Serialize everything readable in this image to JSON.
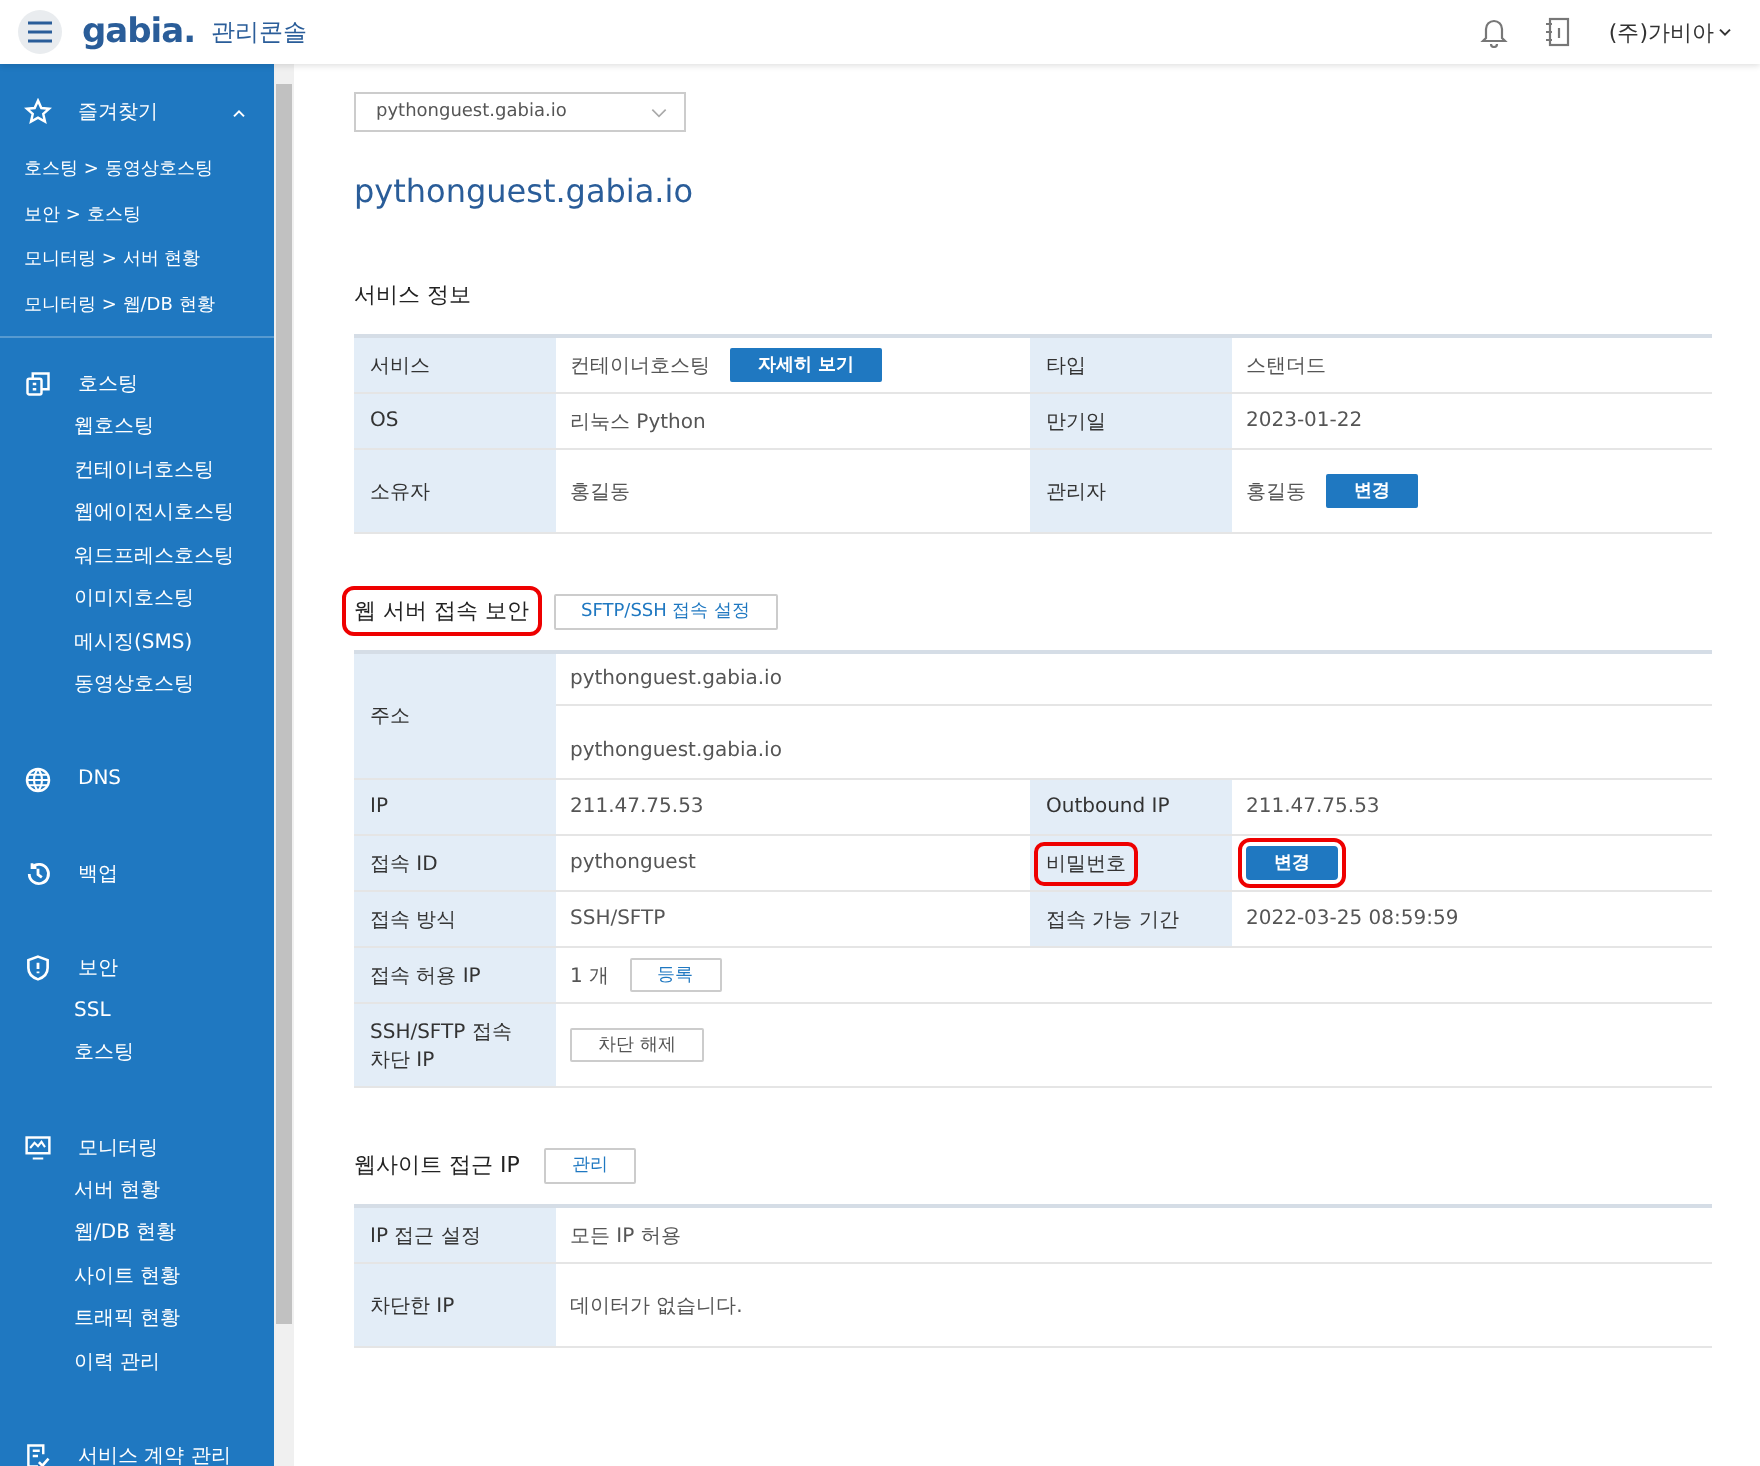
{
  "header": {
    "logo": "gabia.",
    "title": "관리콘솔",
    "user": "(주)가비아"
  },
  "sidebar": {
    "favorites": {
      "label": "즐겨찾기",
      "expanded": true,
      "items": [
        "호스팅 > 동영상호스팅",
        "보안 > 호스팅",
        "모니터링 > 서버 현황",
        "모니터링 > 웹/DB 현황"
      ]
    },
    "groups": [
      {
        "label": "호스팅",
        "children": [
          "웹호스팅",
          "컨테이너호스팅",
          "웹에이전시호스팅",
          "워드프레스호스팅",
          "이미지호스팅",
          "메시징(SMS)",
          "동영상호스팅"
        ]
      },
      {
        "label": "DNS"
      },
      {
        "label": "백업"
      },
      {
        "label": "보안",
        "children": [
          "SSL",
          "호스팅"
        ]
      },
      {
        "label": "모니터링",
        "children": [
          "서버 현황",
          "웹/DB 현황",
          "사이트 현황",
          "트래픽 현황",
          "이력 관리"
        ]
      },
      {
        "label": "서비스 계약 관리"
      }
    ]
  },
  "content": {
    "domain_select": {
      "value": "pythonguest.gabia.io"
    },
    "heading": "pythonguest.gabia.io",
    "sections": [
      {
        "title": "서비스 정보",
        "highlighted": false,
        "rows": [
          {
            "cells": [
              {
                "kind": "label",
                "text": "서비스"
              },
              {
                "kind": "value",
                "text": "컨테이너호스팅",
                "button": {
                  "label": "자세히 보기",
                  "kind": "primary",
                  "highlighted": false
                }
              },
              {
                "kind": "label",
                "text": "타입"
              },
              {
                "kind": "value",
                "text": "스탠더드"
              }
            ]
          },
          {
            "cells": [
              {
                "kind": "label",
                "text": "OS"
              },
              {
                "kind": "value",
                "text": "리눅스 Python"
              },
              {
                "kind": "label",
                "text": "만기일"
              },
              {
                "kind": "value",
                "text": "2023-01-22"
              }
            ]
          },
          {
            "cells": [
              {
                "kind": "label",
                "text": "소유자"
              },
              {
                "kind": "value",
                "text": "홍길동"
              },
              {
                "kind": "label",
                "text": "관리자"
              },
              {
                "kind": "value",
                "text": "홍길동",
                "button": {
                  "label": "변경",
                  "kind": "primary",
                  "highlighted": false
                }
              }
            ]
          }
        ]
      },
      {
        "title": "웹 서버 접속 보안",
        "highlighted": true,
        "button": {
          "label": "SFTP/SSH 접속 설정",
          "kind": "outline",
          "highlighted": false
        },
        "rows": [
          {
            "cells": [
              {
                "kind": "label",
                "text": "주소"
              },
              {
                "kind": "value",
                "lines": [
                  "pythonguest.gabia.io",
                  "pythonguest.gabia.io"
                ]
              }
            ]
          },
          {
            "cells": [
              {
                "kind": "label",
                "text": "IP"
              },
              {
                "kind": "value",
                "text": "211.47.75.53"
              },
              {
                "kind": "label",
                "text": "Outbound IP"
              },
              {
                "kind": "value",
                "text": "211.47.75.53"
              }
            ]
          },
          {
            "cells": [
              {
                "kind": "label",
                "text": "접속 ID"
              },
              {
                "kind": "value",
                "text": "pythonguest"
              },
              {
                "kind": "label",
                "text": "비밀번호",
                "highlighted": true
              },
              {
                "kind": "value",
                "button": {
                  "label": "변경",
                  "kind": "primary",
                  "highlighted": true
                }
              }
            ]
          },
          {
            "cells": [
              {
                "kind": "label",
                "text": "접속 방식"
              },
              {
                "kind": "value",
                "text": "SSH/SFTP"
              },
              {
                "kind": "label",
                "text": "접속 가능 기간"
              },
              {
                "kind": "value",
                "text": "2022-03-25 08:59:59"
              }
            ]
          },
          {
            "cells": [
              {
                "kind": "label",
                "text": "접속 허용 IP"
              },
              {
                "kind": "value",
                "text": "1 개",
                "button": {
                  "label": "등록",
                  "kind": "outline",
                  "highlighted": false
                }
              }
            ]
          },
          {
            "cells": [
              {
                "kind": "label",
                "text": "SSH/SFTP 접속 차단 IP"
              },
              {
                "kind": "value",
                "button": {
                  "label": "차단 해제",
                  "kind": "outline-dark",
                  "highlighted": false
                }
              }
            ]
          }
        ]
      },
      {
        "title": "웹사이트 접근 IP",
        "highlighted": false,
        "button": {
          "label": "관리",
          "kind": "outline",
          "highlighted": false
        },
        "rows": [
          {
            "cells": [
              {
                "kind": "label",
                "text": "IP 접근 설정"
              },
              {
                "kind": "value",
                "text": "모든 IP 허용"
              }
            ]
          },
          {
            "cells": [
              {
                "kind": "label",
                "text": "차단한 IP"
              },
              {
                "kind": "value",
                "text": "데이터가 없습니다."
              }
            ]
          }
        ]
      }
    ]
  }
}
